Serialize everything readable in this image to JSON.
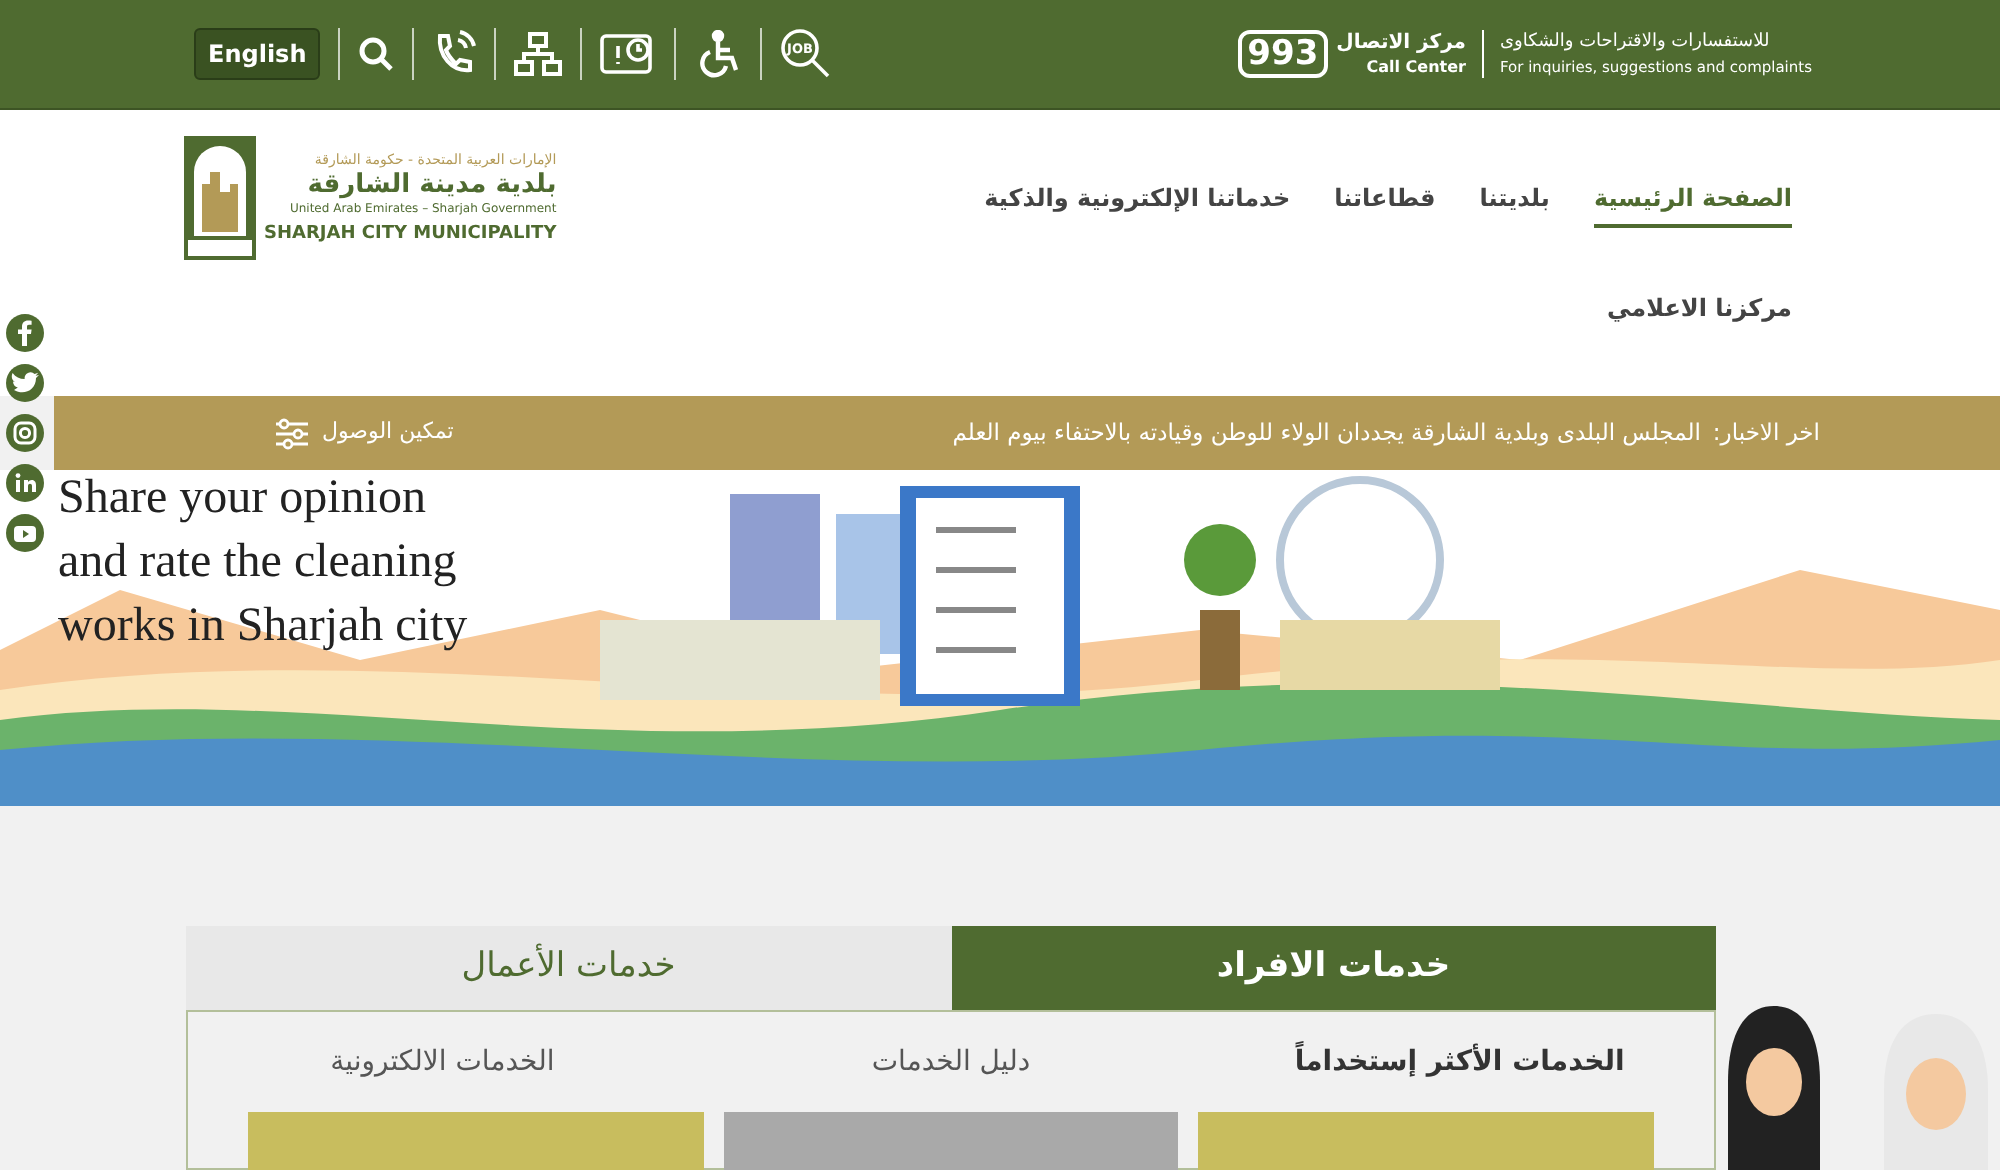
{
  "top_bar": {
    "language_button": "English",
    "job_icon_text": "JOB",
    "call_center": {
      "number": "993",
      "title_ar": "مركز الاتصال",
      "title_en": "Call Center"
    },
    "inquiries": {
      "ar": "للاستفسارات والاقتراحات والشكاوى",
      "en": "For inquiries, suggestions and complaints"
    }
  },
  "logo": {
    "line_1": "الإمارات العربية المتحدة - حكومة الشارقة",
    "line_2": "بلدية مدينة الشارقة",
    "line_3": "United Arab Emirates – Sharjah Government",
    "line_4": "SHARJAH CITY MUNICIPALITY"
  },
  "nav": [
    {
      "label": "الصفحة الرئيسية",
      "selected": true
    },
    {
      "label": "بلديتنا",
      "selected": false
    },
    {
      "label": "قطاعاتنا",
      "selected": false
    },
    {
      "label": "خدماتنا الإلكترونية والذكية",
      "selected": false
    },
    {
      "label": "مركزنا الاعلامي",
      "selected": false
    }
  ],
  "news_bar": {
    "label": "اخر الاخبار:",
    "text": "المجلس البلدى وبلدية الشارقة يجددان الولاء للوطن وقيادته بالاحتفاء بيوم العلم",
    "accessibility": "تمكين الوصول"
  },
  "banner": {
    "lines": [
      "Share your opinion",
      "and rate the cleaning",
      "works in Sharjah city"
    ]
  },
  "service_tabs": [
    {
      "label": "خدمات الافراد",
      "selected": true
    },
    {
      "label": "خدمات الأعمال",
      "selected": false
    }
  ],
  "sub_tabs": [
    {
      "label": "الخدمات الأكثر إستخداماً",
      "selected": true
    },
    {
      "label": "دليل الخدمات",
      "selected": false
    },
    {
      "label": "الخدمات الالكترونية",
      "selected": false
    }
  ],
  "cards": [
    {
      "color": "#c8bd5e"
    },
    {
      "color": "#a9a9a9"
    },
    {
      "color": "#c8bd5e"
    }
  ]
}
